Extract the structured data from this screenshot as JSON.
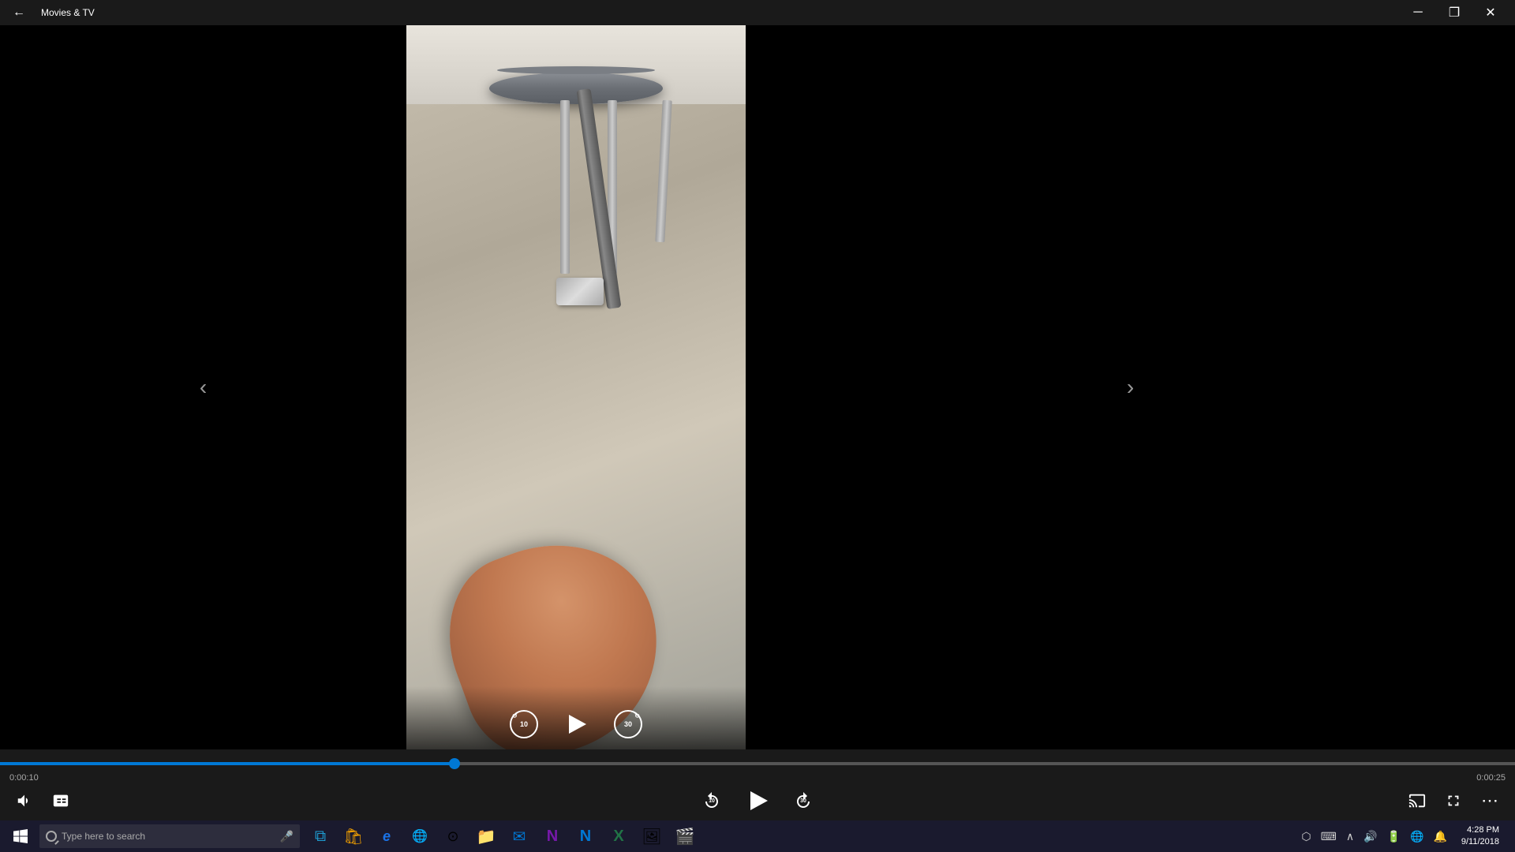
{
  "titlebar": {
    "title": "Movies & TV",
    "back_label": "←",
    "minimize_label": "─",
    "restore_label": "❐",
    "close_label": "✕"
  },
  "player": {
    "current_time": "0:00:10",
    "total_time": "0:00:25",
    "progress_percent": 40,
    "skip_back_label": "10",
    "skip_forward_label": "30",
    "play_label": "▶"
  },
  "nav": {
    "prev_label": "‹",
    "next_label": "›"
  },
  "controls": {
    "volume_label": "🔊",
    "captions_label": "⊡",
    "fullscreen_label": "⤢",
    "more_label": "⋯",
    "cast_label": "⬡"
  },
  "taskbar": {
    "search_placeholder": "Type here to search",
    "time": "4:28 PM",
    "date": "9/11/2018",
    "apps": [
      {
        "name": "Task View",
        "icon": "⧉"
      },
      {
        "name": "Microsoft Store",
        "icon": "🛍"
      },
      {
        "name": "Internet Explorer",
        "icon": "e"
      },
      {
        "name": "Edge",
        "icon": "e"
      },
      {
        "name": "Chrome",
        "icon": "⊙"
      },
      {
        "name": "File Explorer",
        "icon": "📁"
      },
      {
        "name": "Outlook",
        "icon": "✉"
      },
      {
        "name": "OneNote Purple",
        "icon": "N"
      },
      {
        "name": "OneNote Blue",
        "icon": "N"
      },
      {
        "name": "Excel",
        "icon": "X"
      },
      {
        "name": "Photos",
        "icon": "🖼"
      },
      {
        "name": "Films",
        "icon": "🎬"
      }
    ],
    "tray_icons": [
      "⬡",
      "⌨",
      "🔔",
      "🔊",
      "🔋",
      "🌐"
    ]
  }
}
